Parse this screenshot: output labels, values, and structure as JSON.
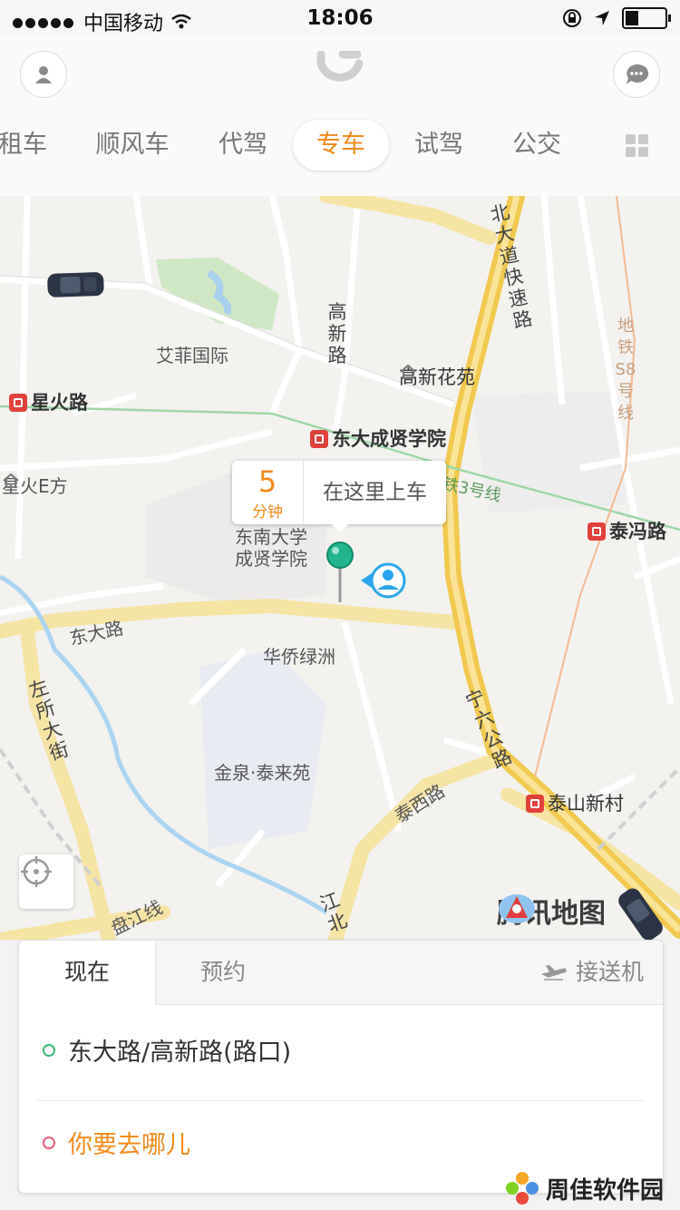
{
  "status_bar": {
    "carrier": "中国移动",
    "time": "18:06"
  },
  "header": {
    "tabs": [
      "租车",
      "顺风车",
      "代驾",
      "专车",
      "试驾",
      "公交"
    ],
    "active_tab": "专车"
  },
  "map": {
    "labels": {
      "aifei": "艾菲国际",
      "gaoxin_road": "高新路",
      "gaoxin_garden": "高新花苑",
      "xinghuo_road": "星火路",
      "dongda_chengxian": "东大成贤学院",
      "xinghuo_e": "星火E方",
      "metro3": "地铁3号线",
      "taifeng_road": "泰冯路",
      "seu_chengxian": "东南大学成贤学院",
      "dongda_road": "东大路",
      "huaqiao": "华侨绿洲",
      "zuosuo": "左所大街",
      "ningliu": "宁六公路",
      "jinquan": "金泉·泰来苑",
      "taixi_road": "泰西路",
      "taishan": "泰山新村",
      "panjiang": "盘江线",
      "jiangbei": "江北",
      "beida_expressway": "北大道快速路",
      "metro_s8": "地铁S8号线"
    },
    "pickup_callout": {
      "eta_value": "5",
      "eta_unit": "分钟",
      "text": "在这里上车"
    },
    "provider": "腾讯地图"
  },
  "booking": {
    "tabs": {
      "now": "现在",
      "reserve": "预约",
      "airport": "接送机"
    },
    "from": "东大路/高新路(路口)",
    "to_placeholder": "你要去哪儿",
    "colors": {
      "from_dot": "#3cb878",
      "to_dot": "#e8607a",
      "accent": "#f28a1c"
    }
  },
  "watermark": "周佳软件园"
}
